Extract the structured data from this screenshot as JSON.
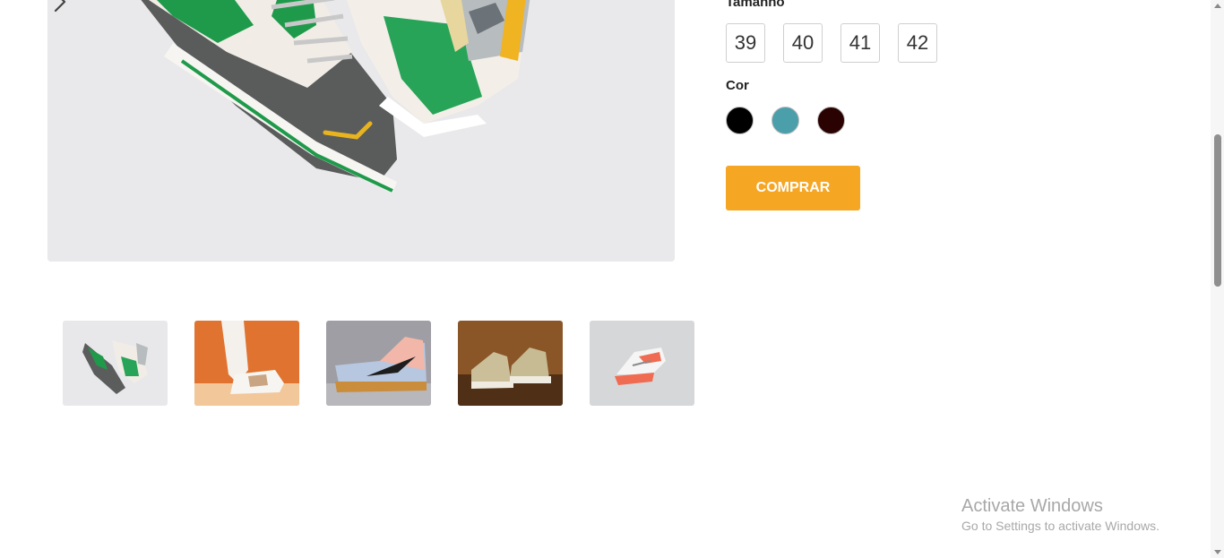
{
  "product": {
    "gallery_next_icon": "chevron-right-icon",
    "size_label": "Tamanho",
    "sizes": [
      "39",
      "40",
      "41",
      "42"
    ],
    "color_label": "Cor",
    "colors": [
      "#000000",
      "#4a9fab",
      "#2a0202"
    ],
    "buy_label": "COMPRAR",
    "accent_color": "#f5a623"
  },
  "thumbnails": [
    {
      "name": "thumbnail-green-sneakers"
    },
    {
      "name": "thumbnail-white-sneakers-orange"
    },
    {
      "name": "thumbnail-nike-dunk"
    },
    {
      "name": "thumbnail-converse-hightops"
    },
    {
      "name": "thumbnail-air-max"
    }
  ],
  "watermark": {
    "title": "Activate Windows",
    "subtitle": "Go to Settings to activate Windows."
  }
}
